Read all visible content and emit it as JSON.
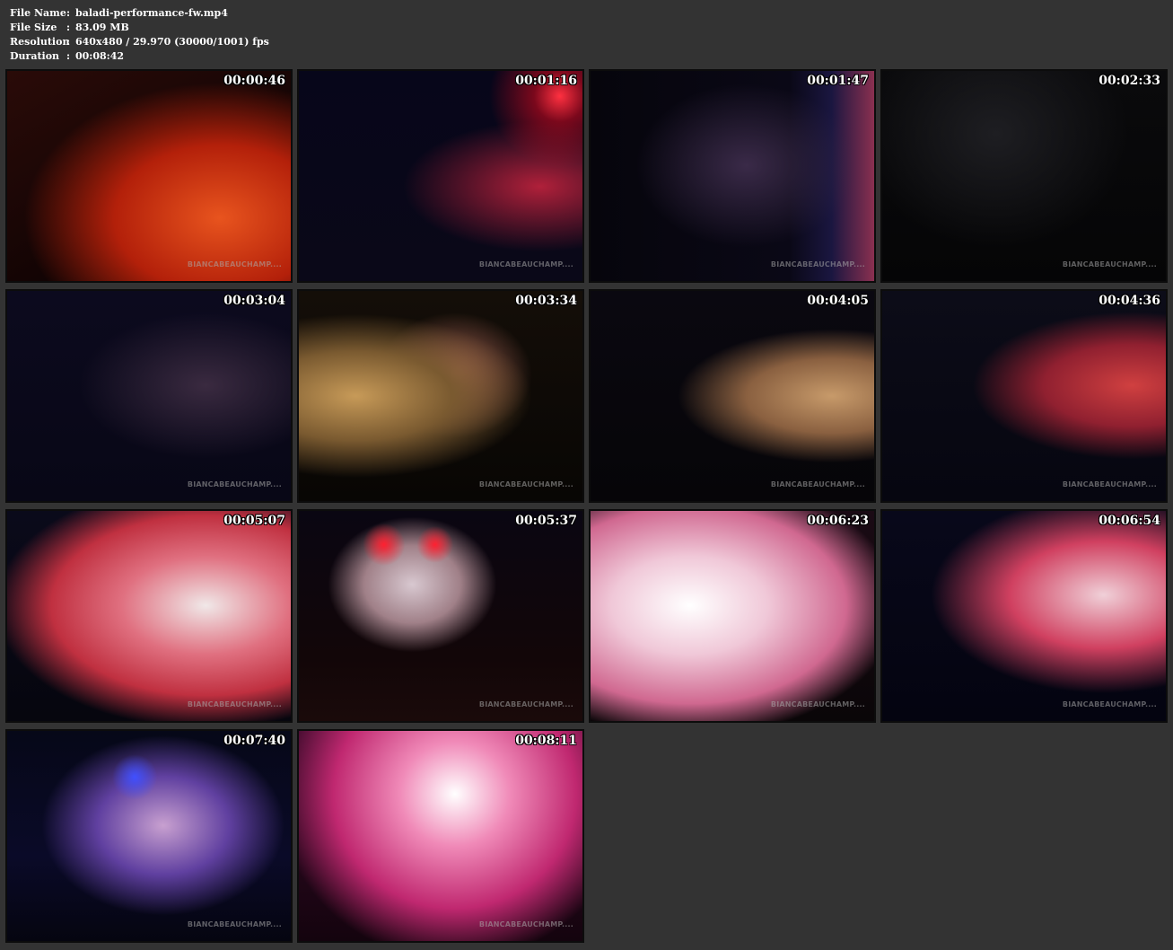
{
  "meta": {
    "rows": [
      {
        "key": "File Name",
        "sep": ":",
        "value": "baladi-performance-fw.mp4"
      },
      {
        "key": "File Size",
        "sep": ":",
        "value": "83.09 MB"
      },
      {
        "key": "Resolution",
        "sep": ":",
        "value": "640x480 / 29.970 (30000/1001) fps"
      },
      {
        "key": "Duration",
        "sep": ":",
        "value": "00:08:42"
      }
    ]
  },
  "watermark": "BIANCABEAUCHAMP....",
  "thumbnails": [
    {
      "timestamp": "00:00:46"
    },
    {
      "timestamp": "00:01:16"
    },
    {
      "timestamp": "00:01:47"
    },
    {
      "timestamp": "00:02:33"
    },
    {
      "timestamp": "00:03:04"
    },
    {
      "timestamp": "00:03:34"
    },
    {
      "timestamp": "00:04:05"
    },
    {
      "timestamp": "00:04:36"
    },
    {
      "timestamp": "00:05:07"
    },
    {
      "timestamp": "00:05:37"
    },
    {
      "timestamp": "00:06:23"
    },
    {
      "timestamp": "00:06:54"
    },
    {
      "timestamp": "00:07:40"
    },
    {
      "timestamp": "00:08:11"
    }
  ],
  "colors": {
    "background": "#333333",
    "text": "#ffffff",
    "thumb_border": "#0c0c0c"
  }
}
